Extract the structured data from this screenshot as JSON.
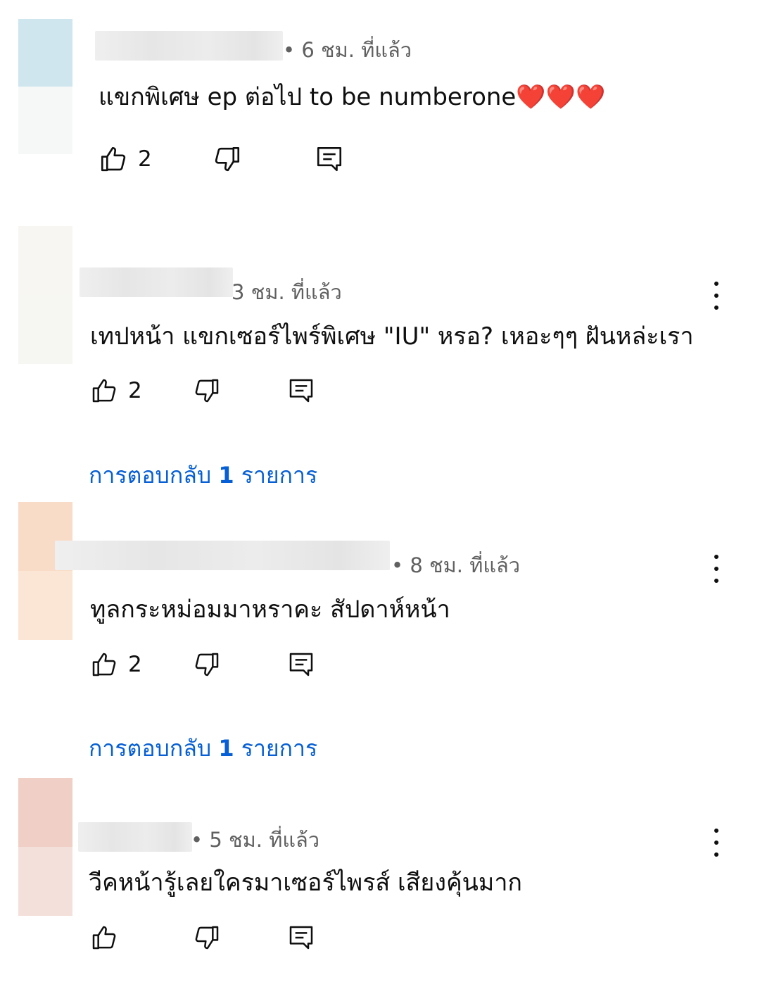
{
  "colors": {
    "link": "#065fd4",
    "meta": "#606060",
    "text": "#0f0f0f"
  },
  "comments": [
    {
      "time": "• 6 ชม. ที่แล้ว",
      "text": "แขกพิเศษ ep ต่อไป to be numberone",
      "hearts": "❤️❤️❤️",
      "likes": "2",
      "avatar_colors": [
        "#cfe6ee",
        "#f6f8f8"
      ]
    },
    {
      "time": "3 ชม. ที่แล้ว",
      "text": "เทปหน้า แขกเซอร์ไพร์พิเศษ \"IU\" หรอ? เหอะๆๆ ฝันหล่ะเรา",
      "likes": "2",
      "replies_label": "การตอบกลับ",
      "replies_count": "1",
      "replies_unit": "รายการ",
      "avatar_colors": [
        "#f8f6f2",
        "#f6f6f3"
      ]
    },
    {
      "time": "• 8 ชม. ที่แล้ว",
      "text": "ทูลกระหม่อมมาหราคะ สัปดาห์หน้า",
      "likes": "2",
      "replies_label": "การตอบกลับ",
      "replies_count": "1",
      "replies_unit": "รายการ",
      "avatar_colors": [
        "#f9dcc7",
        "#fbe6d6"
      ]
    },
    {
      "time": "• 5 ชม. ที่แล้ว",
      "text": "วีคหน้ารู้เลยใครมาเซอร์ไพรส์ เสียงคุ้นมาก",
      "likes": "",
      "avatar_colors": [
        "#efcfc6",
        "#f4e0da"
      ]
    }
  ]
}
